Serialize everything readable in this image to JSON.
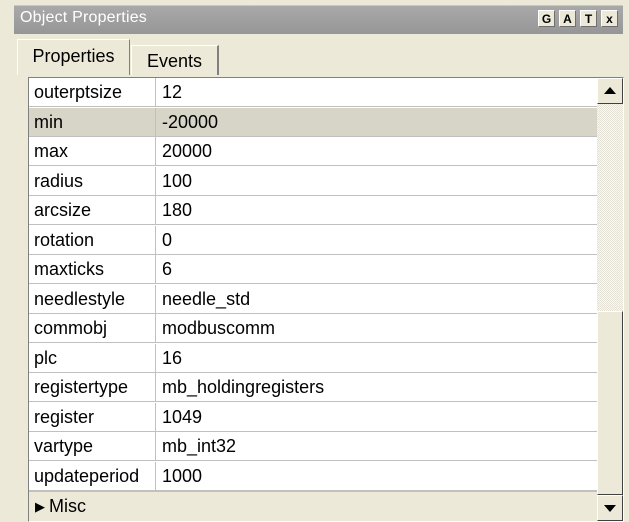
{
  "window": {
    "title": "Object Properties",
    "buttons": [
      "G",
      "A",
      "T",
      "x"
    ]
  },
  "tabs": [
    {
      "label": "Properties",
      "active": true
    },
    {
      "label": "Events",
      "active": false
    }
  ],
  "properties": [
    {
      "name": "outerptsize",
      "value": "12"
    },
    {
      "name": "min",
      "value": "-20000"
    },
    {
      "name": "max",
      "value": "20000"
    },
    {
      "name": "radius",
      "value": "100"
    },
    {
      "name": "arcsize",
      "value": "180"
    },
    {
      "name": "rotation",
      "value": "0"
    },
    {
      "name": "maxticks",
      "value": "6"
    },
    {
      "name": "needlestyle",
      "value": "needle_std"
    },
    {
      "name": "commobj",
      "value": "modbuscomm"
    },
    {
      "name": "plc",
      "value": "16"
    },
    {
      "name": "registertype",
      "value": "mb_holdingregisters"
    },
    {
      "name": "register",
      "value": "1049"
    },
    {
      "name": "vartype",
      "value": "mb_int32"
    },
    {
      "name": "updateperiod",
      "value": "1000"
    }
  ],
  "selected_row": "min",
  "category": {
    "label": "Misc",
    "icon": "triangle-right-icon"
  }
}
